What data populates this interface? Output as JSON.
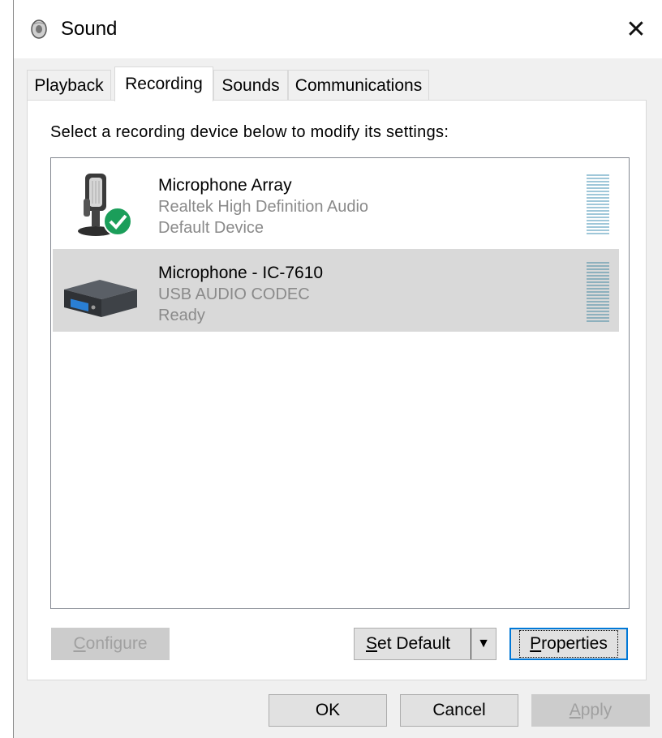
{
  "window": {
    "title": "Sound",
    "close_label": "✕"
  },
  "tabs": [
    {
      "label": "Playback"
    },
    {
      "label": "Recording"
    },
    {
      "label": "Sounds"
    },
    {
      "label": "Communications"
    }
  ],
  "instruction": "Select a recording device below to modify its settings:",
  "devices": [
    {
      "name": "Microphone Array",
      "driver": "Realtek High Definition Audio",
      "status": "Default Device",
      "icon": "microphone-icon",
      "badge": "default-check-icon"
    },
    {
      "name": "Microphone - IC-7610",
      "driver": "USB AUDIO  CODEC",
      "status": "Ready",
      "icon": "usb-codec-device-icon"
    }
  ],
  "buttons": {
    "configure": {
      "accel": "C",
      "rest": "onfigure"
    },
    "set_default": {
      "accel": "S",
      "rest": "et Default",
      "arrow": "▼"
    },
    "properties": {
      "accel": "P",
      "rest": "roperties"
    },
    "ok": "OK",
    "cancel": "Cancel",
    "apply": {
      "accel": "A",
      "rest": "pply"
    }
  },
  "colors": {
    "accent": "#0078d7",
    "selection": "#d9d9d9",
    "check_badge": "#1b9e5a",
    "meter": "#9fc7d9"
  }
}
